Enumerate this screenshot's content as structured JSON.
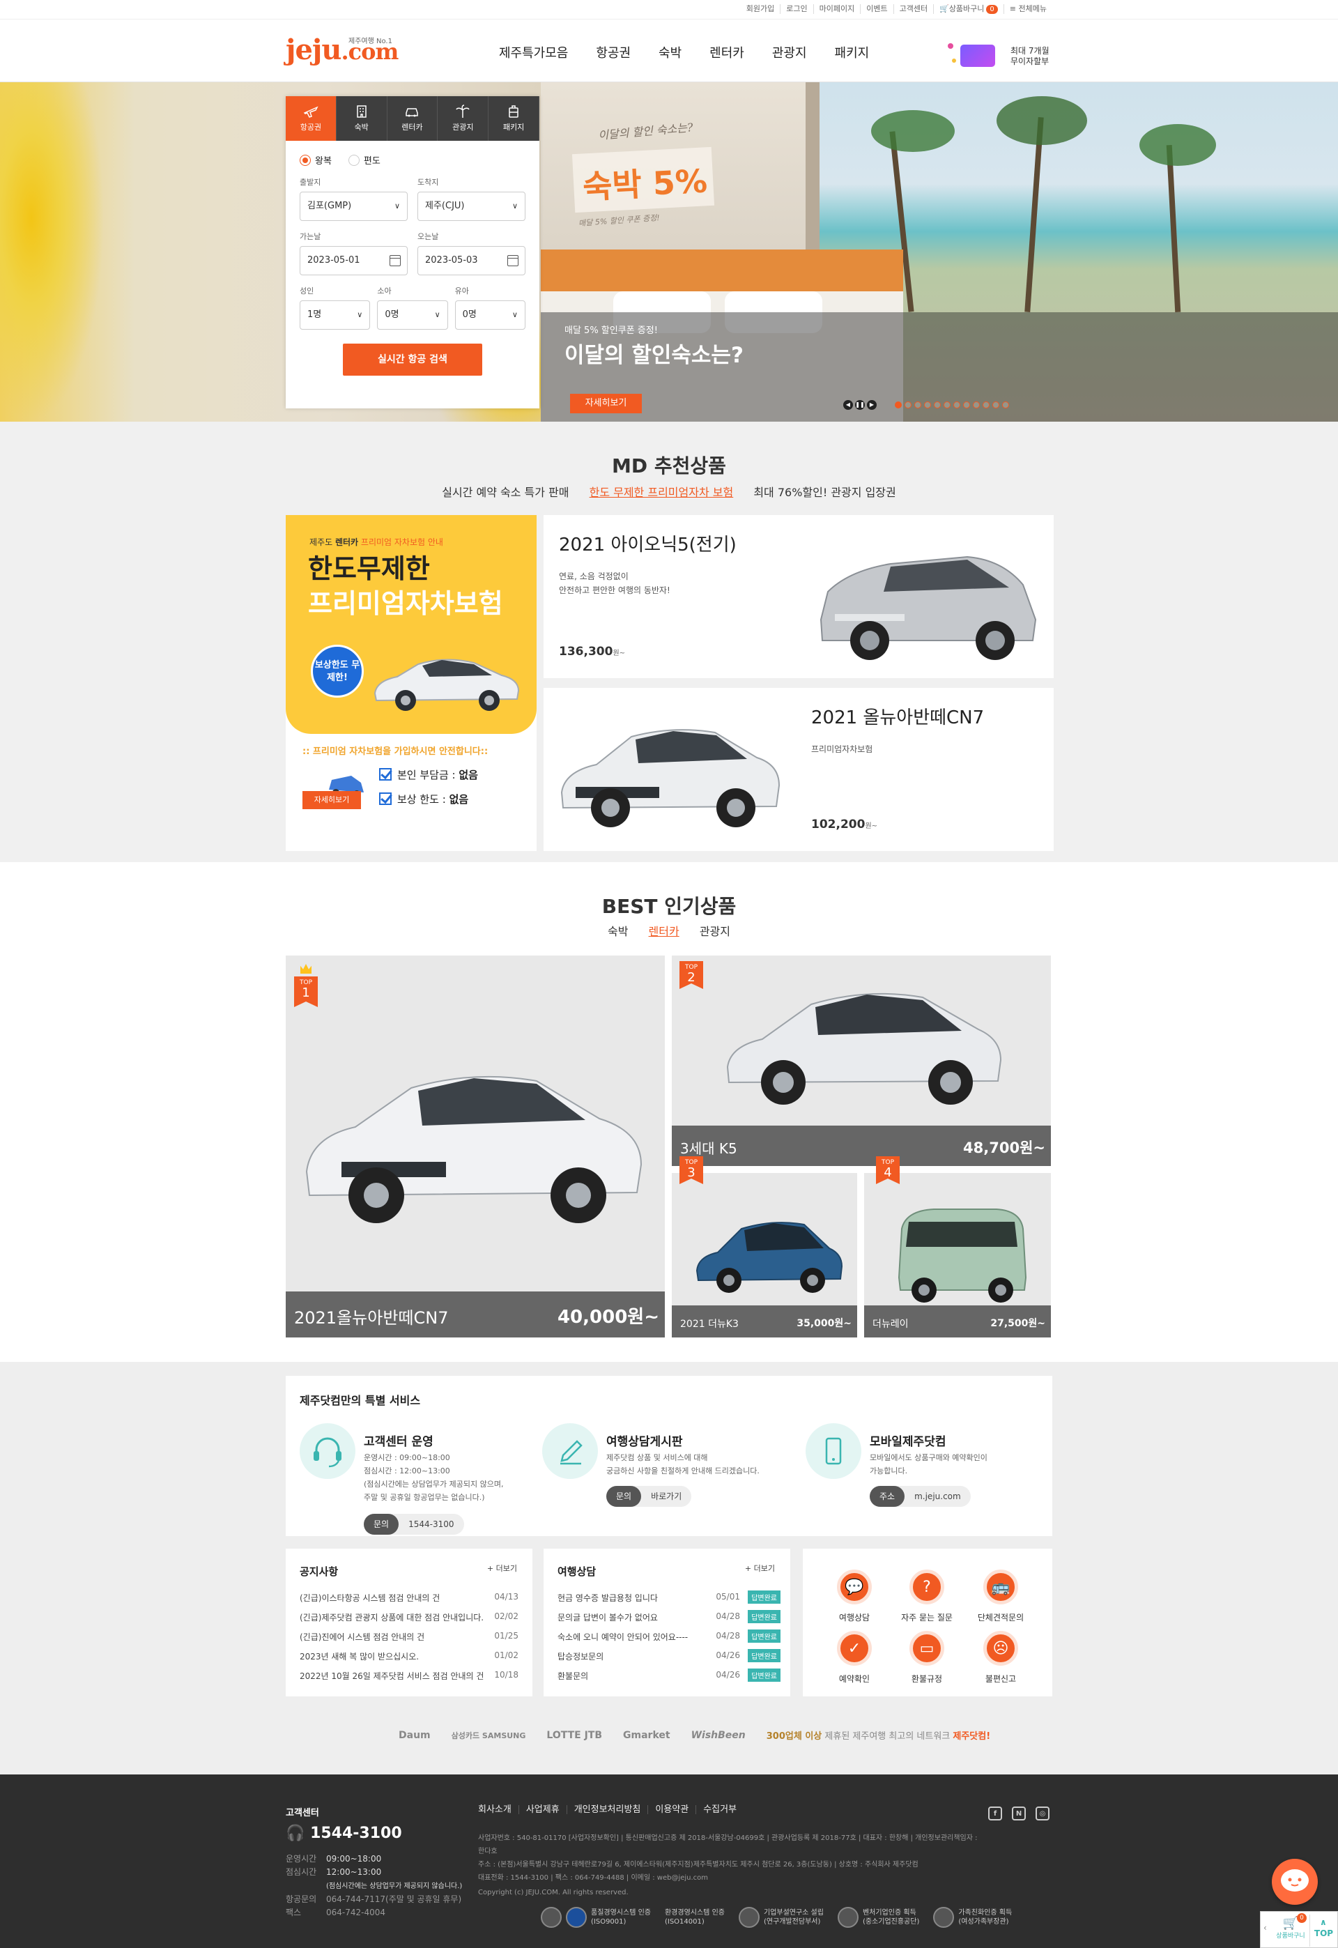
{
  "topbar": {
    "links": [
      "회원가입",
      "로그인",
      "마이페이지",
      "이벤트",
      "고객센터"
    ],
    "cart_label": "상품바구니",
    "cart_count": "0",
    "all_menu": "전체메뉴"
  },
  "header": {
    "logo_main": "jeju",
    "logo_tld": ".com",
    "logo_tag": "제주여행 No.1",
    "nav": [
      "제주특가모음",
      "항공권",
      "숙박",
      "렌터카",
      "관광지",
      "패키지"
    ],
    "promo_line1": "최대 7개월",
    "promo_line2": "무이자할부"
  },
  "search": {
    "tabs": [
      "항공권",
      "숙박",
      "렌터카",
      "관광지",
      "패키지"
    ],
    "trip_types": [
      "왕복",
      "편도"
    ],
    "depart_label": "출발지",
    "depart_value": "김포(GMP)",
    "arrive_label": "도착지",
    "arrive_value": "제주(CJU)",
    "go_label": "가는날",
    "go_value": "2023-05-01",
    "return_label": "오는날",
    "return_value": "2023-05-03",
    "adult_label": "성인",
    "adult_value": "1명",
    "child_label": "소아",
    "child_value": "0명",
    "infant_label": "유아",
    "infant_value": "0명",
    "submit": "실시간 항공 검색"
  },
  "hero": {
    "sign_head": "이달의 할인 숙소는?",
    "sign_text": "숙박 5%",
    "sign_sub": "매달 5% 할인 쿠폰 증정!",
    "small": "매달 5% 할인쿠폰 증정!",
    "title": "이달의 할인숙소는?",
    "button": "자세히보기",
    "slide_count": 12,
    "active_slide": 1
  },
  "md": {
    "title": "MD 추천상품",
    "tabs": [
      "실시간 예약 숙소 특가 판매",
      "한도 무제한 프리미엄자차 보험",
      "최대 76%할인! 관광지 입장권"
    ],
    "banner": {
      "small_a": "제주도",
      "small_b": "렌터카",
      "small_c": "프리미엄 자차보험 안내",
      "big1": "한도무제한",
      "big2": "프리미엄자차보험",
      "circle": "보상한도 무제한!",
      "note": ":: 프리미엄 자차보험을 가입하시면 안전합니다::",
      "check1_a": "본인 부담금 : ",
      "check1_b": "없음",
      "check2_a": "보상 한도 : ",
      "check2_b": "없음",
      "button": "자세히보기"
    },
    "cards": [
      {
        "title": "2021 아이오닉5(전기)",
        "desc1": "연료, 소음 걱정없이",
        "desc2": "안전하고 편안한 여행의 동반자!",
        "price": "136,300",
        "unit": "원~"
      },
      {
        "title": "2021 올뉴아반떼CN7",
        "desc1": "프리미엄자차보험",
        "desc2": "",
        "price": "102,200",
        "unit": "원~"
      }
    ]
  },
  "best": {
    "title": "BEST 인기상품",
    "tabs": [
      "숙박",
      "렌터카",
      "관광지"
    ],
    "top_label": "TOP",
    "items": [
      {
        "rank": "1",
        "name": "2021올뉴아반떼CN7",
        "price": "40,000원~"
      },
      {
        "rank": "2",
        "name": "3세대 K5",
        "price": "48,700원~"
      },
      {
        "rank": "3",
        "name": "2021 더뉴K3",
        "price": "35,000원~"
      },
      {
        "rank": "4",
        "name": "더뉴레이",
        "price": "27,500원~"
      }
    ]
  },
  "services": {
    "title": "제주닷컴만의 특별 서비스",
    "items": [
      {
        "title": "고객센터 운영",
        "lines": [
          "운영시간 : 09:00~18:00",
          "점심시간 : 12:00~13:00",
          "(점심시간에는 상담업무가 제공되지 않으며,",
          "주말 및 공휴일 항공업무는 없습니다.)"
        ],
        "pill_l": "문의",
        "pill_r": "1544-3100"
      },
      {
        "title": "여행상담게시판",
        "lines": [
          "제주닷컴 상품 및 서비스에 대해",
          "궁금하신 사항을 친절하게 안내해 드리겠습니다."
        ],
        "pill_l": "문의",
        "pill_r": "바로가기"
      },
      {
        "title": "모바일제주닷컴",
        "lines": [
          "모바일에서도 상품구매와 예약확인이",
          "가능합니다."
        ],
        "pill_l": "주소",
        "pill_r": "m.jeju.com"
      }
    ]
  },
  "notice": {
    "title": "공지사항",
    "more": "+ 더보기",
    "items": [
      {
        "text": "(긴급)이스타항공 시스템 점검 안내의 건",
        "date": "04/13"
      },
      {
        "text": "(긴급)제주닷컴 관광지 상품에 대한 점검 안내입니다.",
        "date": "02/02"
      },
      {
        "text": "(긴급)진에어 시스템 점검 안내의 건",
        "date": "01/25"
      },
      {
        "text": "2023년 새해 복 많이 받으십시오.",
        "date": "01/02"
      },
      {
        "text": "2022년 10월 26일 제주닷컴 서비스 점검 안내의 건",
        "date": "10/18"
      }
    ]
  },
  "consult": {
    "title": "여행상담",
    "more": "+ 더보기",
    "badge": "답변완료",
    "items": [
      {
        "text": "현금 영수증 발급용청 입니다",
        "date": "05/01"
      },
      {
        "text": "문의글 답변이 볼수가 없어요",
        "date": "04/28"
      },
      {
        "text": "숙소에 오니 예약이 안되어 있어요----",
        "date": "04/28"
      },
      {
        "text": "탑승정보문의",
        "date": "04/26"
      },
      {
        "text": "환불문의",
        "date": "04/26"
      }
    ]
  },
  "quick": {
    "items": [
      "여행상담",
      "자주 묻는 질문",
      "단체견적문의",
      "예약확인",
      "환불규정",
      "불편신고"
    ]
  },
  "partners": {
    "logos": [
      "Daum",
      "삼성카드 SAMSUNG",
      "LOTTE JTB",
      "Gmarket",
      "WishBeen"
    ],
    "note_a": "300업체 이상",
    "note_b": " 제휴된 제주여행 최고의 네트워크 ",
    "note_c": "제주닷컴!"
  },
  "footer": {
    "cs_title": "고객센터",
    "tel": "1544-3100",
    "hours": [
      {
        "k": "운영시간",
        "v": "09:00~18:00"
      },
      {
        "k": "점심시간",
        "v": "12:00~13:00"
      },
      {
        "k": "",
        "v": "(점심시간에는 상담업무가 제공되지 않습니다.)"
      },
      {
        "k": "항공문의",
        "v": "064-744-7117(주말 및 공휴일 휴무)"
      },
      {
        "k": "팩스",
        "v": "064-742-4004"
      }
    ],
    "links": [
      "회사소개",
      "사업제휴",
      "개인정보처리방침",
      "이용약관",
      "수집거부"
    ],
    "info1": "사업자번호 : 540-81-01170 [사업자정보확인] | 통신판매업신고증 제 2018-서울강남-04699호 | 관광사업등록 제 2018-77호 | 대표자 : 한창해 | 개인정보관리책임자 : 한다호",
    "info2": "주소 : (본점)서울특별시 강남구 테헤란로79길 6, 제이에스타워(제주지점)제주특별자치도 제주시 첨단로 26, 3층(도남동) | 상호명 : 주식회사 제주닷컴",
    "info3": "대표전화 : 1544-3100 | 팩스 : 064-749-4488 | 이메일 : web@jeju.com",
    "copy": "Copyright (c) JEJU.COM. All rights reserved.",
    "sns": [
      "f",
      "N",
      "◎"
    ],
    "certs": [
      {
        "a": "품질경영시스템 인증",
        "b": "(ISO9001)"
      },
      {
        "a": "환경경영시스템 인증",
        "b": "(ISO14001)"
      },
      {
        "a": "기업부설연구소 설립",
        "b": "(연구개발전담부서)"
      },
      {
        "a": "벤처기업인증 획득",
        "b": "(중소기업진흥공단)"
      },
      {
        "a": "가족친화인증 획득",
        "b": "(여성가족부장관)"
      }
    ]
  },
  "dock": {
    "label": "상품바구니",
    "count": "0",
    "top": "TOP"
  },
  "colors": {
    "accent": "#f15a22",
    "dark": "#3e3e3e",
    "teal": "#3ab5b0"
  }
}
